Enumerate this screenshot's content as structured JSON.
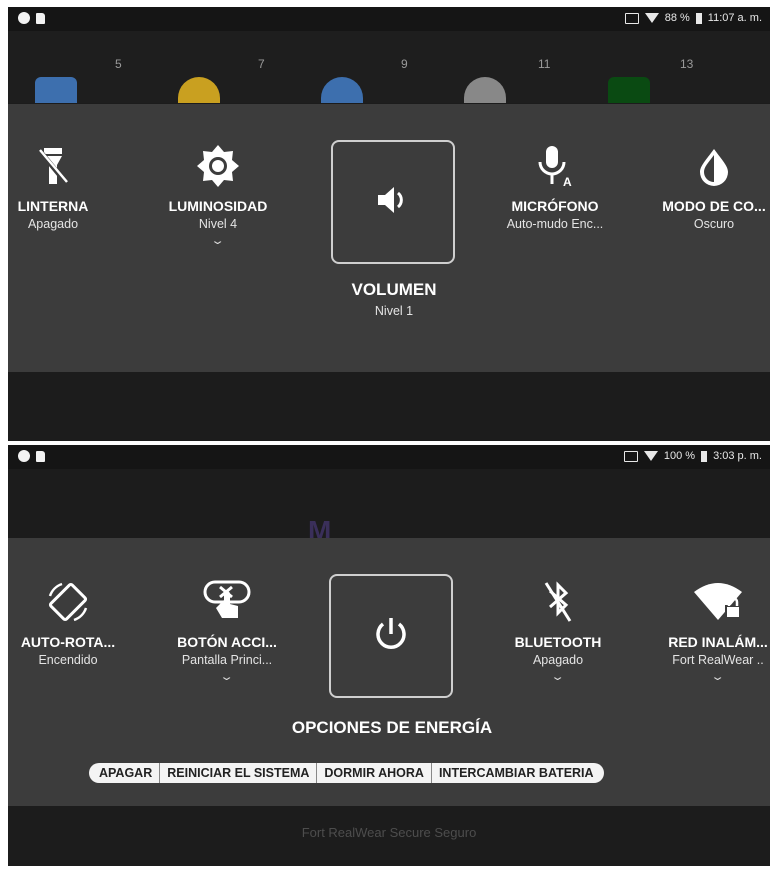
{
  "screen_top": {
    "status": {
      "battery": "88 %",
      "time": "11:07 a. m."
    },
    "background_numbers": [
      "5",
      "7",
      "9",
      "11",
      "13"
    ],
    "tiles": [
      {
        "label": "LINTERNA",
        "sub": "Apagado",
        "icon": "flashlight-off-icon"
      },
      {
        "label": "LUMINOSIDAD",
        "sub": "Nivel 4",
        "icon": "brightness-icon"
      },
      {
        "label": "MICRÓFONO",
        "sub": "Auto-mudo Enc...",
        "icon": "microphone-auto-icon"
      },
      {
        "label": "MODO DE CO...",
        "sub": "Oscuro",
        "icon": "contrast-icon"
      }
    ],
    "selected": {
      "label": "VOLUMEN",
      "sub": "Nivel 1",
      "icon": "volume-icon"
    }
  },
  "screen_bottom": {
    "status": {
      "battery": "100 %",
      "time": "3:03 p. m."
    },
    "tiles": [
      {
        "label": "AUTO-ROTA...",
        "sub": "Encendido",
        "icon": "auto-rotate-icon"
      },
      {
        "label": "BOTÓN ACCI...",
        "sub": "Pantalla Princi...",
        "icon": "action-button-icon"
      },
      {
        "label": "BLUETOOTH",
        "sub": "Apagado",
        "icon": "bluetooth-off-icon"
      },
      {
        "label": "RED INALÁM...",
        "sub": "Fort RealWear ..",
        "icon": "wifi-lock-icon"
      }
    ],
    "selected": {
      "label": "OPCIONES DE ENERGÍA",
      "icon": "power-icon"
    },
    "actions": [
      "APAGAR",
      "REINICIAR EL SISTEMA",
      "DORMIR AHORA",
      "INTERCAMBIAR BATERIA"
    ],
    "footer": "Fort RealWear Secure Seguro"
  }
}
